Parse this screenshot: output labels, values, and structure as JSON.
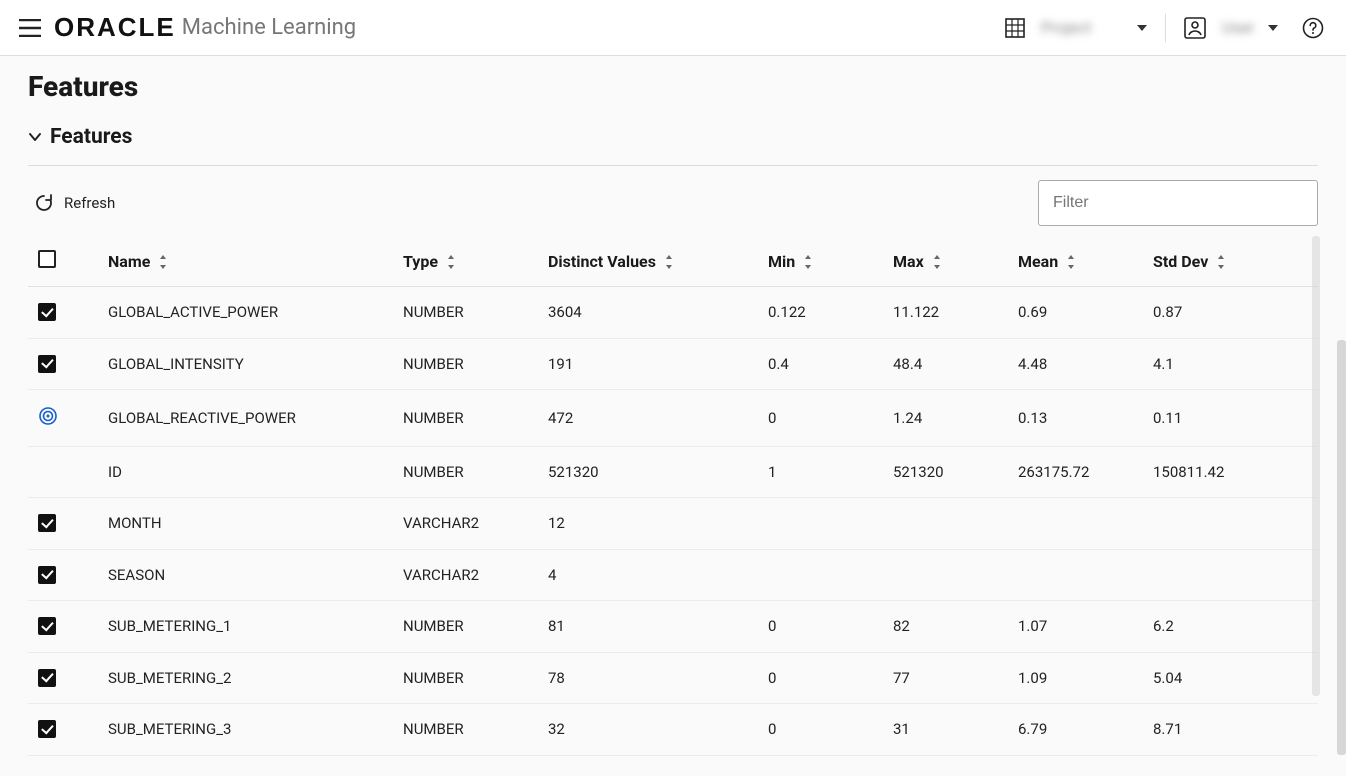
{
  "header": {
    "brand": "ORACLE",
    "product": "Machine Learning",
    "project_blur": "Project",
    "user_blur": "User"
  },
  "page": {
    "title": "Features",
    "section_title": "Features",
    "refresh_label": "Refresh",
    "filter_placeholder": "Filter"
  },
  "table": {
    "headers": {
      "name": "Name",
      "type": "Type",
      "distinct": "Distinct Values",
      "min": "Min",
      "max": "Max",
      "mean": "Mean",
      "std": "Std Dev"
    },
    "rows": [
      {
        "state": "checked",
        "name": "GLOBAL_ACTIVE_POWER",
        "type": "NUMBER",
        "distinct": "3604",
        "min": "0.122",
        "max": "11.122",
        "mean": "0.69",
        "std": "0.87"
      },
      {
        "state": "checked",
        "name": "GLOBAL_INTENSITY",
        "type": "NUMBER",
        "distinct": "191",
        "min": "0.4",
        "max": "48.4",
        "mean": "4.48",
        "std": "4.1"
      },
      {
        "state": "target",
        "name": "GLOBAL_REACTIVE_POWER",
        "type": "NUMBER",
        "distinct": "472",
        "min": "0",
        "max": "1.24",
        "mean": "0.13",
        "std": "0.11"
      },
      {
        "state": "none",
        "name": "ID",
        "type": "NUMBER",
        "distinct": "521320",
        "min": "1",
        "max": "521320",
        "mean": "263175.72",
        "std": "150811.42"
      },
      {
        "state": "checked",
        "name": "MONTH",
        "type": "VARCHAR2",
        "distinct": "12",
        "min": "",
        "max": "",
        "mean": "",
        "std": ""
      },
      {
        "state": "checked",
        "name": "SEASON",
        "type": "VARCHAR2",
        "distinct": "4",
        "min": "",
        "max": "",
        "mean": "",
        "std": ""
      },
      {
        "state": "checked",
        "name": "SUB_METERING_1",
        "type": "NUMBER",
        "distinct": "81",
        "min": "0",
        "max": "82",
        "mean": "1.07",
        "std": "6.2"
      },
      {
        "state": "checked",
        "name": "SUB_METERING_2",
        "type": "NUMBER",
        "distinct": "78",
        "min": "0",
        "max": "77",
        "mean": "1.09",
        "std": "5.04"
      },
      {
        "state": "checked",
        "name": "SUB_METERING_3",
        "type": "NUMBER",
        "distinct": "32",
        "min": "0",
        "max": "31",
        "mean": "6.79",
        "std": "8.71"
      }
    ]
  }
}
